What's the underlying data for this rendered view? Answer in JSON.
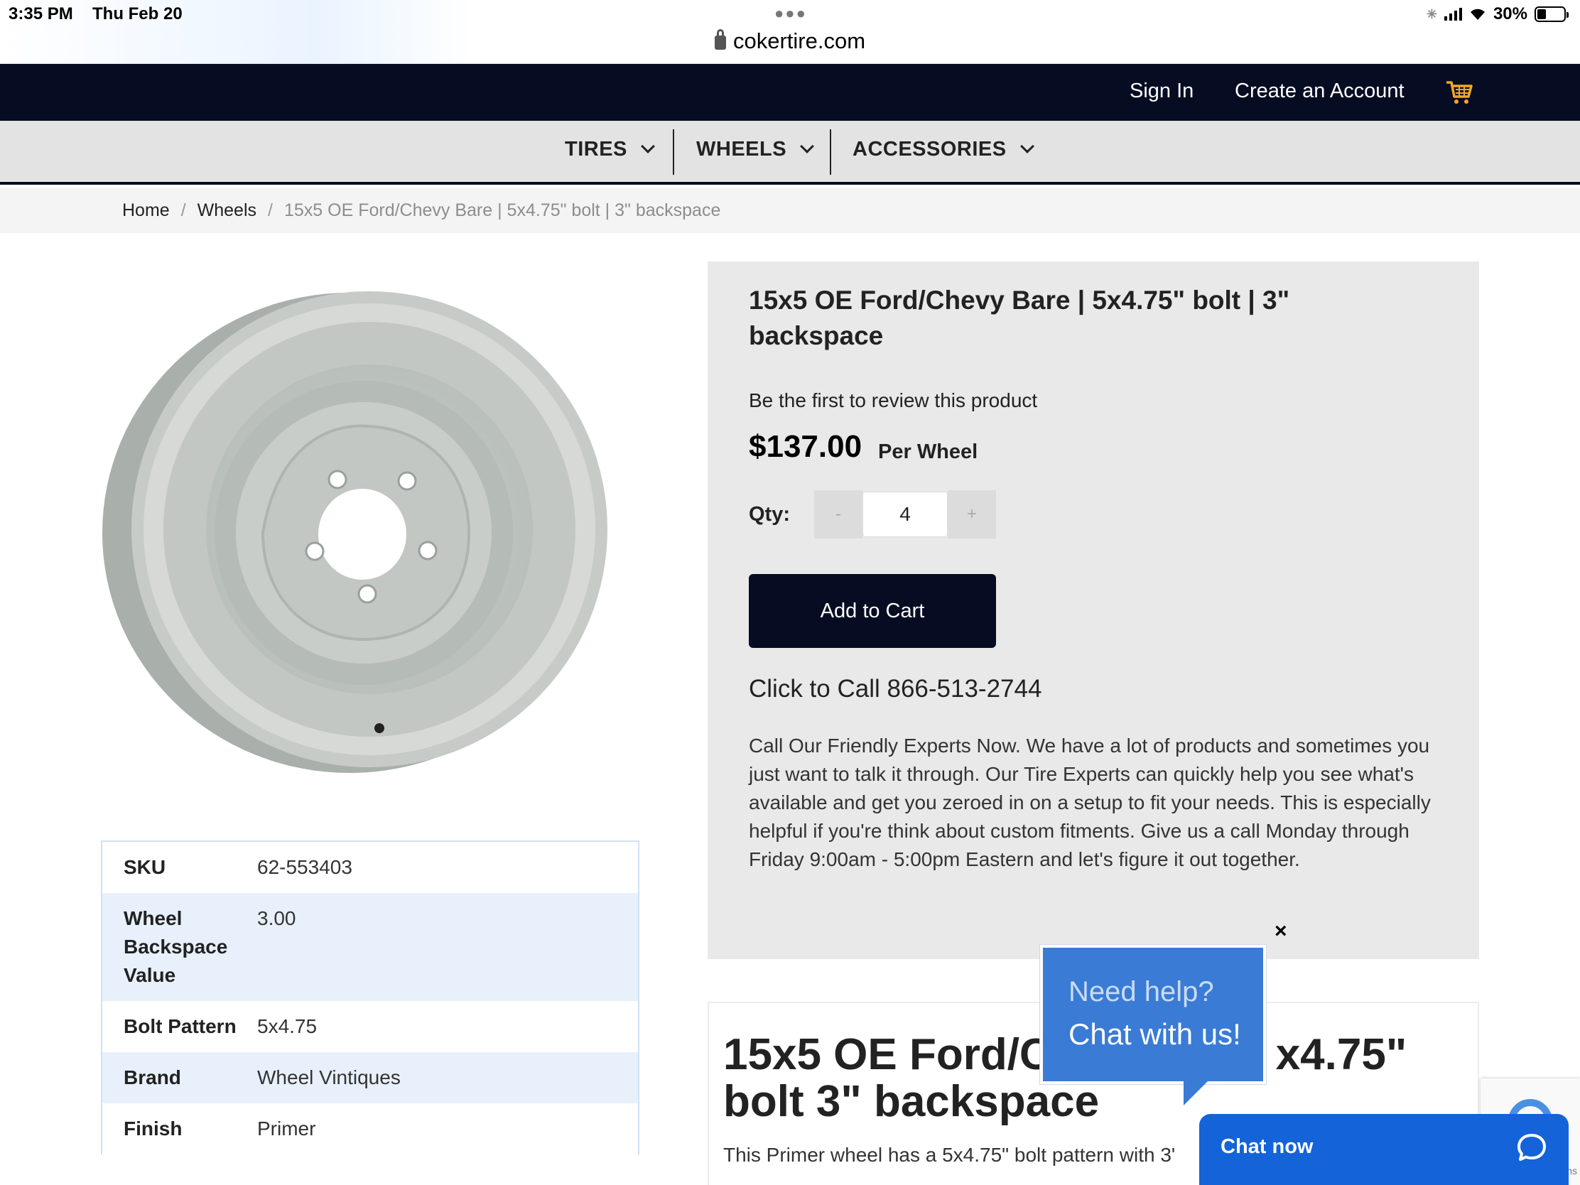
{
  "status_bar": {
    "time": "3:35 PM",
    "date": "Thu Feb 20",
    "url": "cokertire.com",
    "battery": "30%"
  },
  "top_nav": {
    "sign_in": "Sign In",
    "create_account": "Create an Account",
    "cart_icon": "cart-icon"
  },
  "category_nav": {
    "items": [
      {
        "label": "TIRES"
      },
      {
        "label": "WHEELS"
      },
      {
        "label": "ACCESSORIES"
      }
    ]
  },
  "breadcrumb": {
    "home": "Home",
    "wheels": "Wheels",
    "current": "15x5 OE Ford/Chevy Bare | 5x4.75\" bolt | 3\" backspace"
  },
  "product": {
    "title": "15x5 OE Ford/Chevy Bare | 5x4.75\" bolt | 3\" backspace",
    "review_text": "Be the first to review this product",
    "price": "$137.00",
    "price_unit": "Per Wheel",
    "qty_label": "Qty:",
    "qty_minus": "-",
    "qty_value": "4",
    "qty_plus": "+",
    "add_to_cart": "Add to Cart",
    "call_text": "Click to Call 866-513-2744",
    "description": "Call Our Friendly Experts Now. We have a lot of products and sometimes you just want to talk it through. Our Tire Experts can quickly help you see what's available and get you zeroed in on a setup to fit your needs. This is especially helpful if you're think about custom fitments. Give us a call Monday through Friday 9:00am - 5:00pm Eastern and let's figure it out together."
  },
  "specs": [
    {
      "key": "SKU",
      "value": "62-553403"
    },
    {
      "key": "Wheel Backspace Value",
      "value": "3.00"
    },
    {
      "key": "Bolt Pattern",
      "value": "5x4.75"
    },
    {
      "key": "Brand",
      "value": "Wheel Vintiques"
    },
    {
      "key": "Finish",
      "value": "Primer"
    }
  ],
  "details": {
    "title_part1": "15x5 OE Ford/C",
    "title_part2": "x4.75\"",
    "title_line2": "bolt 3\" backspace",
    "text": "This Primer wheel has a 5x4.75\" bolt pattern with 3'"
  },
  "chat": {
    "close": "×",
    "bubble_line1": "Need help?",
    "bubble_line2": "Chat with us!",
    "chat_now": "Chat now"
  },
  "recaptcha_tag": "ms",
  "colors": {
    "nav_dark": "#060d22",
    "chat_blue": "#1463d8",
    "bubble_blue": "#3a7bd5",
    "cart_orange": "#f5a623"
  }
}
